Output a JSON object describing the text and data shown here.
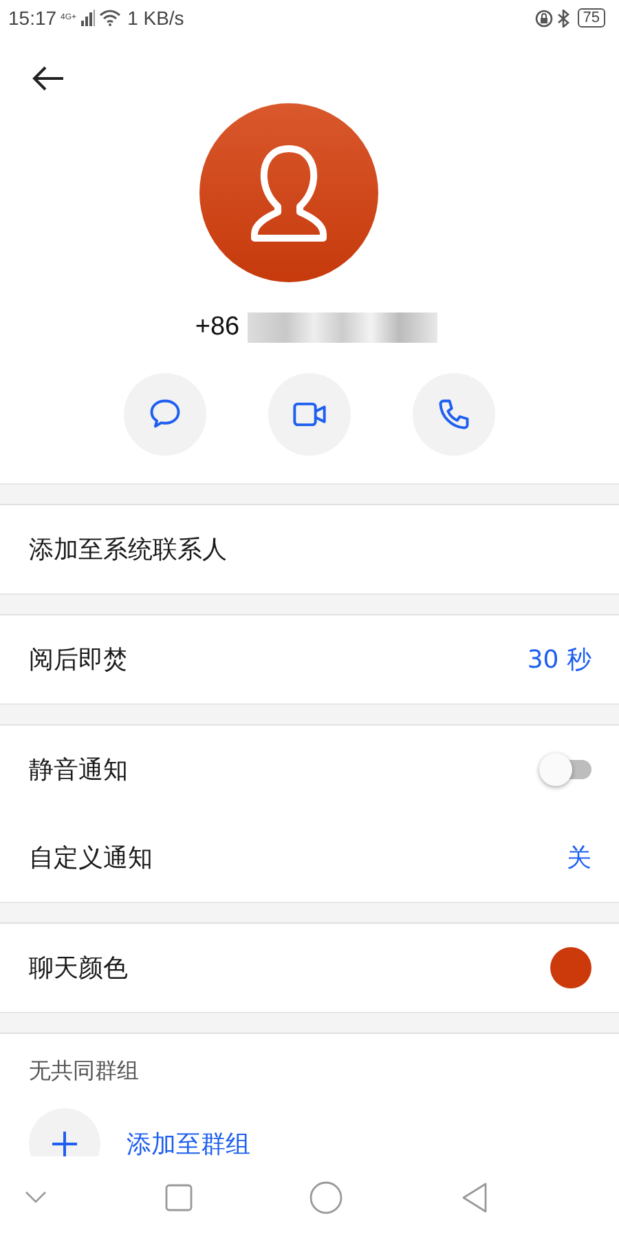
{
  "status_bar": {
    "time": "15:17",
    "network": "4G+",
    "speed": "1 KB/s",
    "battery": "75"
  },
  "contact": {
    "number": "+86",
    "number_redacted": true
  },
  "actions": [
    {
      "kind": "message"
    },
    {
      "kind": "video"
    },
    {
      "kind": "call"
    }
  ],
  "sections": [
    {
      "rows": [
        {
          "kind": "plain",
          "label": "添加至系统联系人"
        }
      ]
    },
    {
      "rows": [
        {
          "kind": "value",
          "label": "阅后即焚",
          "value": "30 秒"
        }
      ]
    },
    {
      "rows": [
        {
          "kind": "toggle",
          "label": "静音通知",
          "on": false
        },
        {
          "kind": "value",
          "label": "自定义通知",
          "value": "关"
        }
      ]
    },
    {
      "rows": [
        {
          "kind": "color",
          "label": "聊天颜色",
          "color": "#cc3a0c"
        }
      ]
    }
  ],
  "groups": {
    "title": "无共同群组",
    "add_label": "添加至群组"
  }
}
